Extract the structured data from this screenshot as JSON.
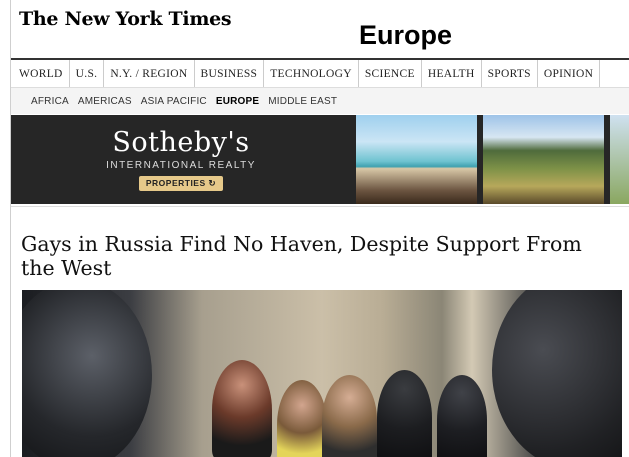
{
  "masthead": {
    "title": "The New York Times"
  },
  "section": {
    "title": "Europe"
  },
  "nav": {
    "items": [
      "WORLD",
      "U.S.",
      "N.Y. / REGION",
      "BUSINESS",
      "TECHNOLOGY",
      "SCIENCE",
      "HEALTH",
      "SPORTS",
      "OPINION"
    ]
  },
  "subnav": {
    "items": [
      "AFRICA",
      "AMERICAS",
      "ASIA PACIFIC",
      "EUROPE",
      "MIDDLE EAST"
    ],
    "active": "EUROPE"
  },
  "ad": {
    "brand": "Sotheby's",
    "subtitle": "INTERNATIONAL REALTY",
    "button": "PROPERTIES ↻"
  },
  "article": {
    "headline": "Gays in Russia Find No Haven, Despite Support From the West"
  }
}
